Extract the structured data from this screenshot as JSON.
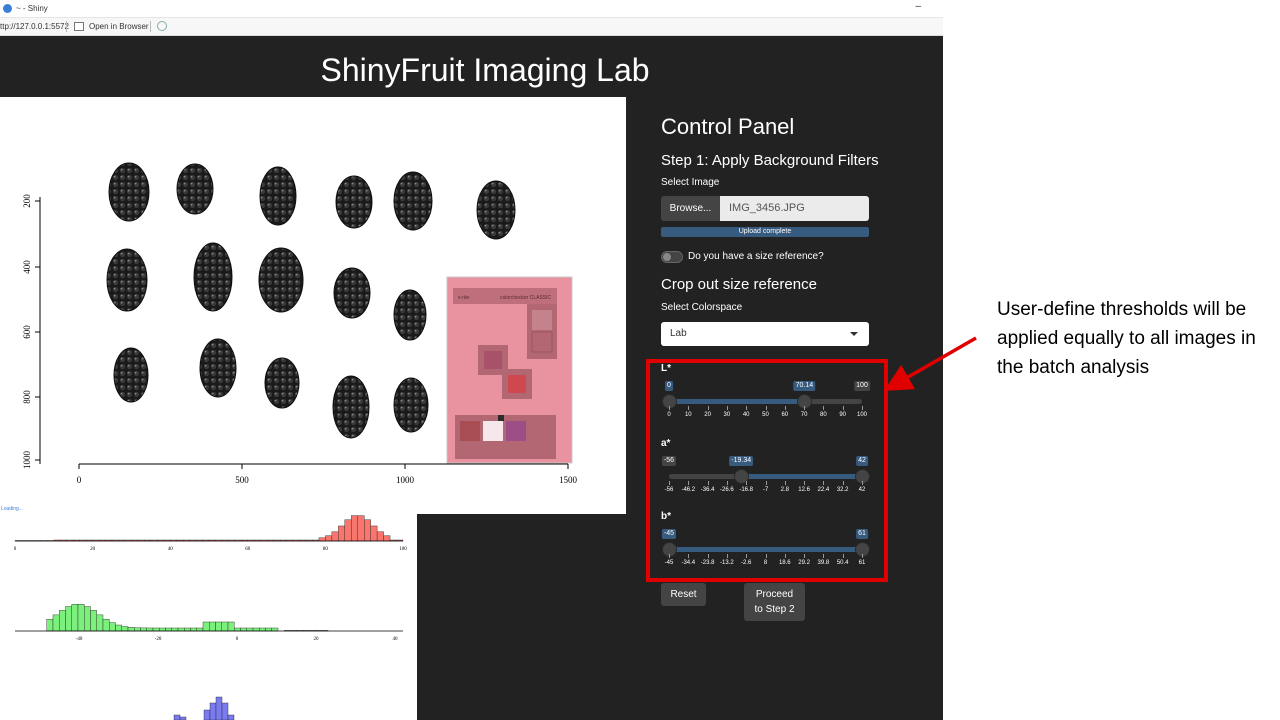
{
  "window": {
    "title": "~ - Shiny",
    "minimize_glyph": "–"
  },
  "addressbar": {
    "url": "ttp://127.0.0.1:5572",
    "open_in_browser": "Open in Browser"
  },
  "app": {
    "title": "ShinyFruit Imaging Lab",
    "loading_text": "Loading..."
  },
  "plot": {
    "y_ticks": [
      "200",
      "400",
      "600",
      "800",
      "1000"
    ],
    "x_ticks": [
      "0",
      "500",
      "1000",
      "1500"
    ],
    "colorchecker_text": "colorchecker CLASSIC",
    "brand_text": "x-rite"
  },
  "histograms": [
    {
      "color": "#f8766d",
      "x_ticks": [
        "0",
        "20",
        "40",
        "60",
        "80",
        "100"
      ]
    },
    {
      "color": "#7cf07c",
      "x_ticks": [
        "-40",
        "-20",
        "0",
        "20",
        "40"
      ]
    },
    {
      "color": "#7b7bf0"
    }
  ],
  "control_panel": {
    "title": "Control Panel",
    "step1_title": "Step 1: Apply Background Filters",
    "select_image_label": "Select Image",
    "browse_label": "Browse...",
    "file_name": "IMG_3456.JPG",
    "upload_status": "Upload complete",
    "size_reference_label": "Do you have a size reference?",
    "size_reference_on": false,
    "crop_title": "Crop out size reference",
    "colorspace_label": "Select Colorspace",
    "colorspace_value": "Lab",
    "reset_label": "Reset",
    "proceed_label_1": "Proceed",
    "proceed_label_2": "to Step 2"
  },
  "sliders": [
    {
      "label": "L*",
      "min": 0,
      "max": 100,
      "low": 0,
      "high": 70.14,
      "min_label": "0",
      "max_label": "100",
      "low_label": "0",
      "high_label": "70.14",
      "ticks": [
        "0",
        "10",
        "20",
        "30",
        "40",
        "50",
        "60",
        "70",
        "80",
        "90",
        "100"
      ]
    },
    {
      "label": "a*",
      "min": -56,
      "max": 42,
      "low": -19.34,
      "high": 42,
      "min_label": "-56",
      "max_label": "42",
      "low_label": "-19.34",
      "high_label": "42",
      "ticks": [
        "-56",
        "-46.2",
        "-36.4",
        "-26.6",
        "-16.8",
        "-7",
        "2.8",
        "12.6",
        "22.4",
        "32.2",
        "42"
      ]
    },
    {
      "label": "b*",
      "min": -45,
      "max": 61,
      "low": -45,
      "high": 61,
      "min_label": "-45",
      "max_label": "61",
      "low_label": "-45",
      "high_label": "61",
      "ticks": [
        "-45",
        "-34.4",
        "-23.8",
        "-13.2",
        "-2.6",
        "8",
        "18.6",
        "29.2",
        "39.8",
        "50.4",
        "61"
      ]
    }
  ],
  "annotation": {
    "text": "User-define thresholds will be applied equally to all images in the batch analysis",
    "box_color": "#e00000"
  }
}
